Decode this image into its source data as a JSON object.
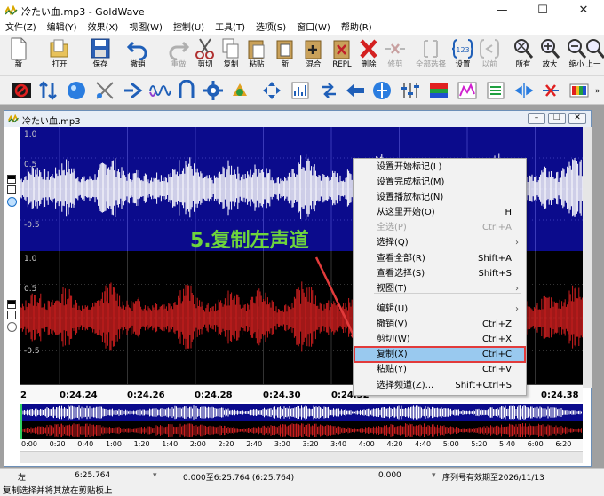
{
  "window": {
    "title": "冷たい血.mp3 - GoldWave"
  },
  "menu": [
    "文件(Z)",
    "编辑(Y)",
    "效果(X)",
    "视图(W)",
    "控制(U)",
    "工具(T)",
    "选项(S)",
    "窗口(W)",
    "帮助(R)"
  ],
  "toolbar": [
    {
      "label": "新",
      "icon": "new-file-icon",
      "enabled": true
    },
    {
      "label": "打开",
      "icon": "open-folder-icon",
      "enabled": true
    },
    {
      "label": "保存",
      "icon": "save-icon",
      "enabled": true
    },
    {
      "label": "撤销",
      "icon": "undo-icon",
      "enabled": true
    },
    {
      "label": "重做",
      "icon": "redo-icon",
      "enabled": false
    },
    {
      "label": "剪切",
      "icon": "cut-icon",
      "enabled": true
    },
    {
      "label": "复制",
      "icon": "copy-icon",
      "enabled": true
    },
    {
      "label": "粘贴",
      "icon": "paste-icon",
      "enabled": true
    },
    {
      "label": "新",
      "icon": "paste-new-icon",
      "enabled": true
    },
    {
      "label": "混合",
      "icon": "mix-icon",
      "enabled": true
    },
    {
      "label": "REPL",
      "icon": "replace-icon",
      "enabled": true
    },
    {
      "label": "删除",
      "icon": "delete-icon",
      "enabled": true
    },
    {
      "label": "修剪",
      "icon": "trim-icon",
      "enabled": false
    },
    {
      "label": "全部选择",
      "icon": "select-all-icon",
      "enabled": false
    },
    {
      "label": "设置",
      "icon": "set-selection-icon",
      "enabled": true
    },
    {
      "label": "以前",
      "icon": "previous-icon",
      "enabled": false
    },
    {
      "label": "所有",
      "icon": "zoom-all-icon",
      "enabled": true
    },
    {
      "label": "放大",
      "icon": "zoom-in-icon",
      "enabled": true
    },
    {
      "label": "缩小",
      "icon": "zoom-out-icon",
      "enabled": true
    },
    {
      "label": "上一",
      "icon": "zoom-previous-icon",
      "enabled": true
    }
  ],
  "doc": {
    "title": "冷たい血.mp3"
  },
  "channels": {
    "left_labels": [
      "1.0",
      "0.5",
      "-0.5"
    ],
    "right_labels": [
      "1.0",
      "0.5",
      "-0.5"
    ]
  },
  "timeline": [
    "2",
    "0:24.24",
    "0:24.26",
    "0:24.28",
    "0:24.30",
    "0:24.32",
    "0:24.38"
  ],
  "overview_ticks": [
    "0:00",
    "0:20",
    "0:40",
    "1:00",
    "1:20",
    "1:40",
    "2:00",
    "2:20",
    "2:40",
    "3:00",
    "3:20",
    "3:40",
    "4:00",
    "4:20",
    "4:40",
    "5:00",
    "5:20",
    "5:40",
    "6:00",
    "6:20"
  ],
  "annotation": "5.复制左声道",
  "context_menu": [
    {
      "label": "设置开始标记(L)",
      "shortcut": "",
      "submenu": false,
      "enabled": true
    },
    {
      "label": "设置完成标记(M)",
      "shortcut": "",
      "submenu": false,
      "enabled": true
    },
    {
      "label": "设置播放标记(N)",
      "shortcut": "",
      "submenu": false,
      "enabled": true
    },
    {
      "label": "从这里开始(O)",
      "shortcut": "H",
      "submenu": false,
      "enabled": true
    },
    {
      "label": "全选(P)",
      "shortcut": "Ctrl+A",
      "submenu": false,
      "enabled": false
    },
    {
      "label": "选择(Q)",
      "shortcut": "",
      "submenu": true,
      "enabled": true
    },
    {
      "label": "查看全部(R)",
      "shortcut": "Shift+A",
      "submenu": false,
      "enabled": true
    },
    {
      "label": "查看选择(S)",
      "shortcut": "Shift+S",
      "submenu": false,
      "enabled": true
    },
    {
      "label": "视图(T)",
      "shortcut": "",
      "submenu": true,
      "enabled": true
    },
    {
      "label": "编辑(U)",
      "shortcut": "",
      "submenu": true,
      "enabled": true
    },
    {
      "label": "撤销(V)",
      "shortcut": "Ctrl+Z",
      "submenu": false,
      "enabled": true
    },
    {
      "label": "剪切(W)",
      "shortcut": "Ctrl+X",
      "submenu": false,
      "enabled": true
    },
    {
      "label": "复制(X)",
      "shortcut": "Ctrl+C",
      "submenu": false,
      "enabled": true
    },
    {
      "label": "粘贴(Y)",
      "shortcut": "Ctrl+V",
      "submenu": false,
      "enabled": true
    },
    {
      "label": "选择频道(Z)...",
      "shortcut": "Shift+Ctrl+S",
      "submenu": false,
      "enabled": true
    }
  ],
  "status": {
    "channel": "左",
    "length": "6:25.764",
    "selection": "0.000至6:25.764 (6:25.764)",
    "position": "0.000",
    "license": "序列号有效期至2026/11/13",
    "hint": "复制选择并将其放在剪贴板上"
  },
  "colors": {
    "left_channel_bg": "#0b0b8c",
    "right_channel_bg": "#000000",
    "left_wave": "#ffffff",
    "right_wave": "#c81e1e",
    "highlight": "#99c9ef",
    "annotation": "#6ed53c",
    "arrow": "#e23b3b"
  }
}
